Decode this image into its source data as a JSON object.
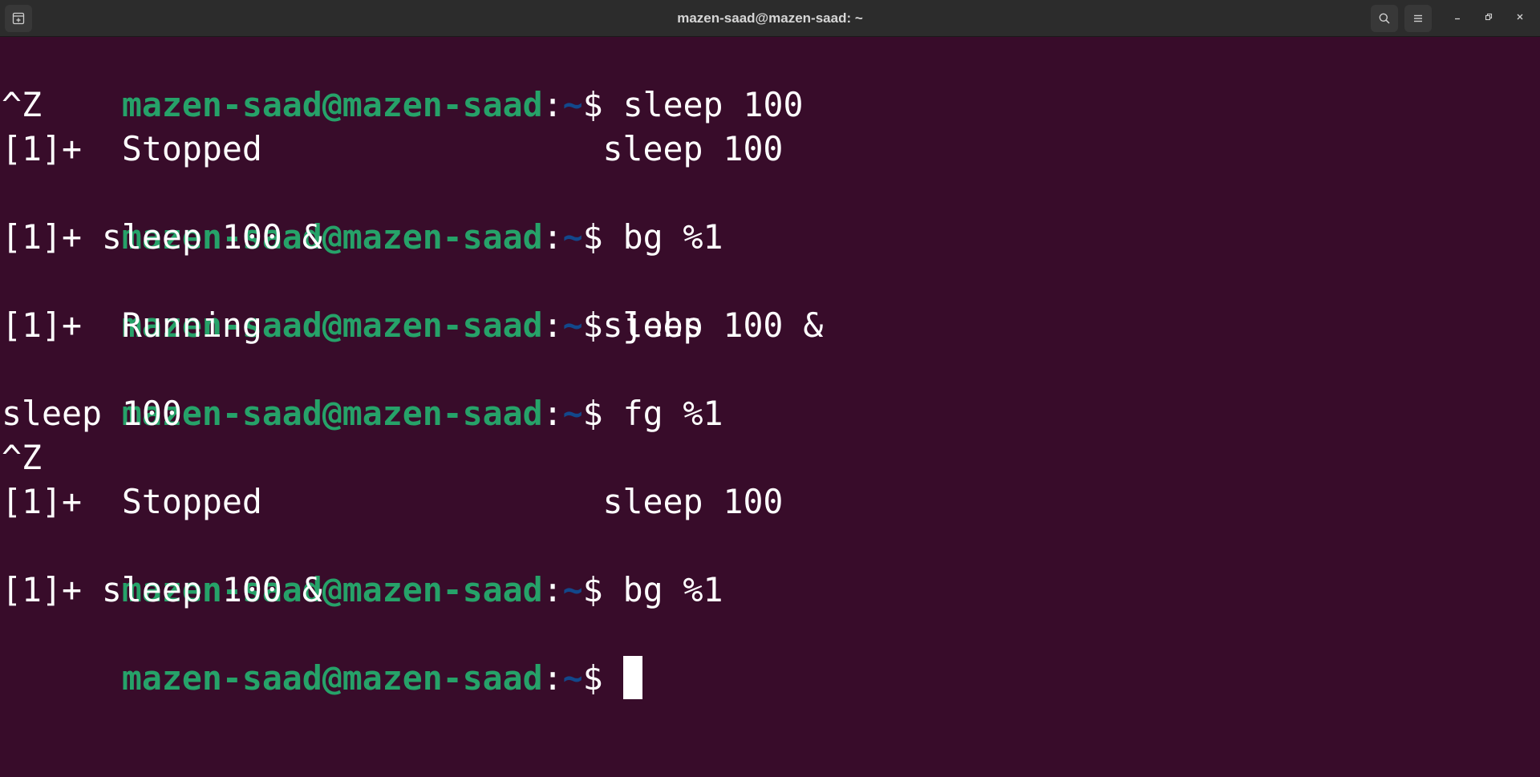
{
  "window": {
    "title": "mazen-saad@mazen-saad: ~"
  },
  "prompt": {
    "user_host": "mazen-saad@mazen-saad",
    "separator": ":",
    "path": "~",
    "symbol": "$ "
  },
  "lines": [
    {
      "type": "prompt",
      "command": "sleep 100"
    },
    {
      "type": "output",
      "text": "^Z"
    },
    {
      "type": "output",
      "text": "[1]+  Stopped                 sleep 100"
    },
    {
      "type": "prompt",
      "command": "bg %1"
    },
    {
      "type": "output",
      "text": "[1]+ sleep 100 &"
    },
    {
      "type": "prompt",
      "command": "jobs"
    },
    {
      "type": "output",
      "text": "[1]+  Running                 sleep 100 &"
    },
    {
      "type": "prompt",
      "command": "fg %1"
    },
    {
      "type": "output",
      "text": "sleep 100"
    },
    {
      "type": "output",
      "text": "^Z"
    },
    {
      "type": "output",
      "text": "[1]+  Stopped                 sleep 100"
    },
    {
      "type": "prompt",
      "command": "bg %1"
    },
    {
      "type": "output",
      "text": "[1]+ sleep 100 &"
    },
    {
      "type": "prompt",
      "command": "",
      "cursor": true
    }
  ],
  "icons": {
    "new_tab": "new-tab-icon",
    "search": "search-icon",
    "menu": "hamburger-menu-icon",
    "minimize": "minimize-icon",
    "maximize": "maximize-icon",
    "close": "close-icon"
  },
  "colors": {
    "background": "#380c2a",
    "user_host": "#26a269",
    "path": "#12488b",
    "text": "#ffffff",
    "titlebar": "#2c2c2c"
  }
}
